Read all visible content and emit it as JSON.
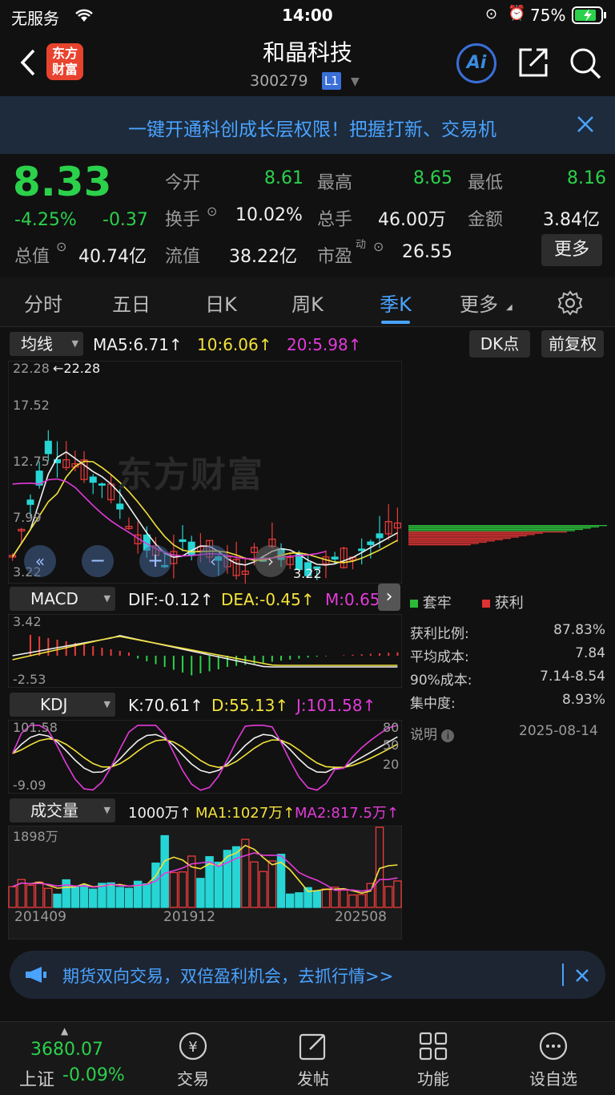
{
  "status_bar": {
    "carrier": "无服务",
    "time": "14:00",
    "battery": "75%"
  },
  "header": {
    "logo_text_1": "东方",
    "logo_text_2": "财富",
    "title": "和晶科技",
    "code": "300279",
    "level": "L1",
    "ai_label": "Ai"
  },
  "banner": {
    "text": "一键开通科创成长层权限！把握打新、交易机"
  },
  "quote": {
    "price": "8.33",
    "change_pct": "-4.25%",
    "change": "-0.37",
    "open_label": "今开",
    "open": "8.61",
    "high_label": "最高",
    "high": "8.65",
    "low_label": "最低",
    "low": "8.16",
    "turnover_label": "换手",
    "turnover": "10.02%",
    "volume_label": "总手",
    "volume": "46.00万",
    "amount_label": "金额",
    "amount": "3.84亿",
    "mcap_label": "总值",
    "mcap": "40.74亿",
    "float_label": "流值",
    "float_cap": "38.22亿",
    "pe_label": "市盈",
    "pe_sup": "动",
    "pe": "26.55",
    "more_label": "更多"
  },
  "tabs": [
    "分时",
    "五日",
    "日K",
    "周K",
    "季K",
    "更多"
  ],
  "main_chart": {
    "ma_selector": "均线",
    "ma5": "MA5:6.71↑",
    "ma10": "10:6.06↑",
    "ma20": "20:5.98↑",
    "dk_button": "DK点",
    "fq_button": "前复权",
    "y_labels": [
      "22.28",
      "17.52",
      "12.75",
      "7.99",
      "3.22"
    ],
    "max_annot": "←22.28",
    "min_annot": "3.22",
    "watermark": "东方财富"
  },
  "macd": {
    "selector": "MACD",
    "dif": "DIF:-0.12↑",
    "dea": "DEA:-0.45↑",
    "m": "M:0.65",
    "y_top": "3.42",
    "y_bottom": "-2.53"
  },
  "kdj": {
    "selector": "KDJ",
    "k": "K:70.61↑",
    "d": "D:55.13↑",
    "j": "J:101.58↑",
    "y_top": "101.58",
    "y_bottom": "-9.09",
    "lv80": "80",
    "lv50": "50",
    "lv20": "20"
  },
  "volume": {
    "selector": "成交量",
    "vol": "1000万↑",
    "ma1": "MA1:1027万↑",
    "ma2": "MA2:817.5万↑",
    "y_top": "1898万",
    "dates": [
      "201409",
      "201912",
      "202508"
    ]
  },
  "chips": {
    "legend_trapped": "套牢",
    "legend_profit": "获利",
    "rows": [
      {
        "label": "获利比例:",
        "value": "87.83%"
      },
      {
        "label": "平均成本:",
        "value": "7.84"
      },
      {
        "label": "90%成本:",
        "value": "7.14-8.54"
      },
      {
        "label": "集中度:",
        "value": "8.93%"
      }
    ],
    "note_label": "说明",
    "date": "2025-08-14"
  },
  "ad": {
    "text": "期货双向交易，双倍盈利机会，去抓行情>>"
  },
  "bottom_nav": {
    "index_value": "3680.07",
    "index_name": "上证",
    "index_change": "-0.09%",
    "items": [
      "交易",
      "发帖",
      "功能",
      "设自选"
    ]
  },
  "colors": {
    "up": "#ef3b3b",
    "down": "#27d5d5",
    "accent": "#4aa3ff",
    "ma5": "#f0f0f0",
    "ma10": "#f3e23b",
    "ma20": "#e23bd9"
  }
}
